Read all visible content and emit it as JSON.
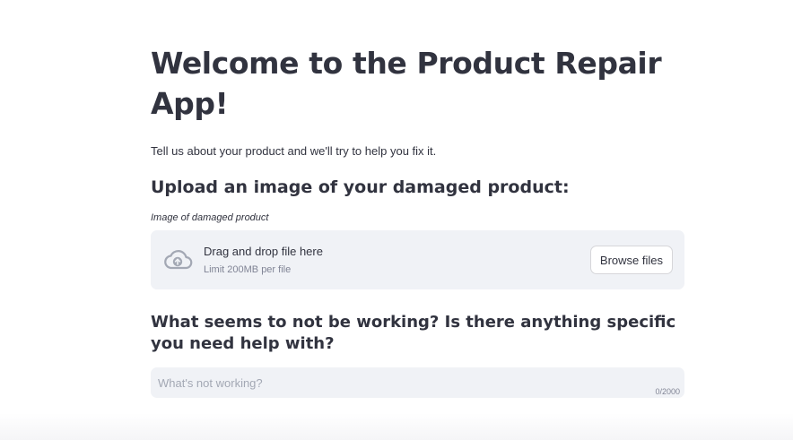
{
  "header": {
    "title": "Welcome to the Product Repair App!",
    "intro": "Tell us about your product and we'll try to help you fix it."
  },
  "upload": {
    "heading": "Upload an image of your damaged product:",
    "label": "Image of damaged product",
    "drop_text": "Drag and drop file here",
    "limit_text": "Limit 200MB per file",
    "browse_label": "Browse files",
    "icon": "cloud-upload-icon"
  },
  "problem": {
    "question": "What seems to not be working? Is there anything specific you need help with?",
    "placeholder": "What's not working?",
    "value": "",
    "char_count": "0/2000"
  },
  "colors": {
    "text": "#31333f",
    "input_bg": "#f0f2f6",
    "muted": "#808495",
    "icon": "#a3a8b4"
  }
}
